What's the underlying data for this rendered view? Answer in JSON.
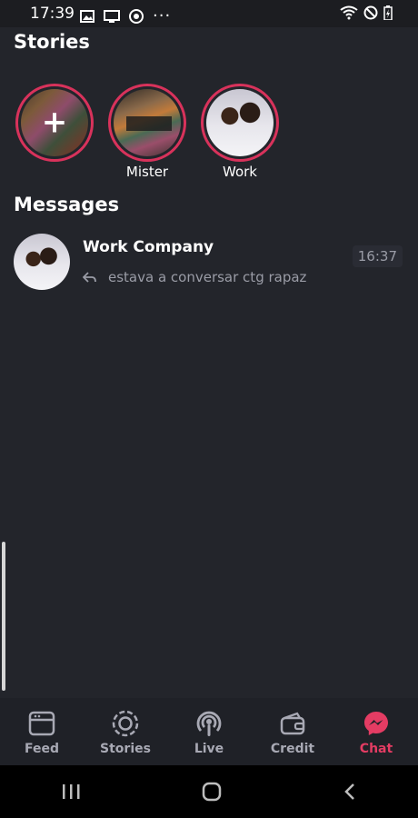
{
  "status_bar": {
    "time": "17:39",
    "left_icons": [
      "image-icon",
      "cast-icon",
      "chrome-icon",
      "more-dots-icon"
    ],
    "right_icons": [
      "wifi-icon",
      "do-not-disturb-icon",
      "battery-icon"
    ]
  },
  "stories": {
    "title": "Stories",
    "items": [
      {
        "label": "",
        "type": "add-story"
      },
      {
        "label": "Mister",
        "type": "story"
      },
      {
        "label": "Work",
        "type": "story"
      }
    ]
  },
  "messages": {
    "title": "Messages",
    "items": [
      {
        "name": "Work Company",
        "preview": "estava a conversar ctg rapaz",
        "time": "16:37",
        "reply_icon": "reply-icon"
      }
    ]
  },
  "bottom_nav": {
    "items": [
      {
        "label": "Feed",
        "icon": "feed-icon",
        "active": false
      },
      {
        "label": "Stories",
        "icon": "stories-icon",
        "active": false
      },
      {
        "label": "Live",
        "icon": "live-icon",
        "active": false
      },
      {
        "label": "Credit",
        "icon": "wallet-icon",
        "active": false
      },
      {
        "label": "Chat",
        "icon": "messenger-icon",
        "active": true
      }
    ]
  },
  "colors": {
    "background": "#23252b",
    "accent": "#e43c63",
    "story_ring": "#d8325b",
    "muted_text": "#9a9ca6"
  },
  "system_nav": [
    "recents-icon",
    "home-icon",
    "back-icon"
  ]
}
